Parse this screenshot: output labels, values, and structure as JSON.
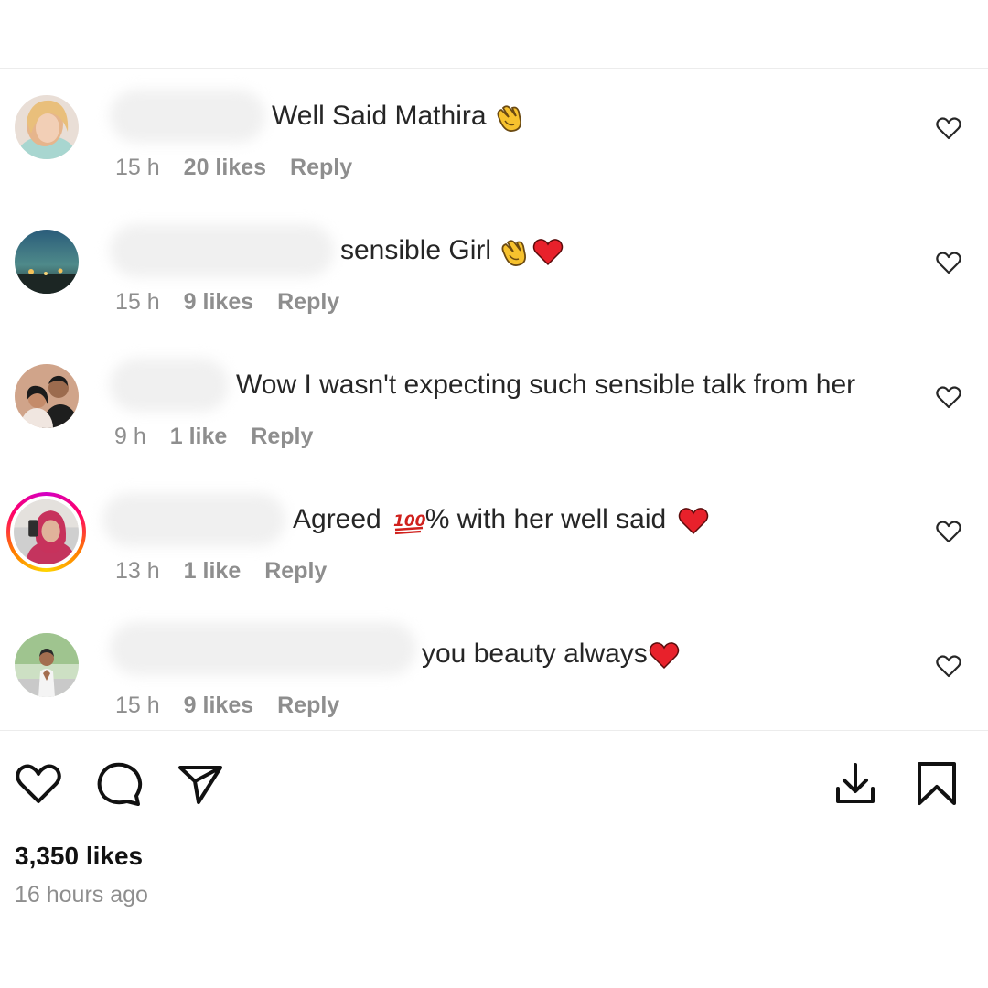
{
  "comments": [
    {
      "text": "Well Said Mathira",
      "emojis": [
        "clapping-hands"
      ],
      "time": "15 h",
      "likes": "20 likes",
      "reply": "Reply",
      "avatar": "woman-blonde-avatar",
      "story_ring": false
    },
    {
      "text": "sensible Girl",
      "emojis": [
        "clapping-hands",
        "red-heart"
      ],
      "time": "15 h",
      "likes": "9 likes",
      "reply": "Reply",
      "avatar": "city-night-avatar",
      "story_ring": false
    },
    {
      "text": "Wow I wasn't expecting such sensible talk from her",
      "emojis": [],
      "time": "9 h",
      "likes": "1 like",
      "reply": "Reply",
      "avatar": "couple-avatar",
      "story_ring": false
    },
    {
      "text_before": "Agreed",
      "text_after": "% with her well said",
      "emojis": [
        "hundred-points",
        "red-heart"
      ],
      "time": "13 h",
      "likes": "1 like",
      "reply": "Reply",
      "avatar": "pink-hijab-avatar",
      "story_ring": true
    },
    {
      "text": "you beauty always",
      "emojis": [
        "red-heart"
      ],
      "time": "15 h",
      "likes": "9 likes",
      "reply": "Reply",
      "avatar": "man-standing-avatar",
      "story_ring": false
    }
  ],
  "actions": {
    "like": "heart-icon",
    "comment": "comment-icon",
    "share": "send-icon",
    "download": "download-icon",
    "save": "bookmark-icon"
  },
  "post": {
    "likes": "3,350 likes",
    "time_ago": "16 hours ago"
  },
  "colors": {
    "text": "#262626",
    "muted": "#8e8e8e",
    "heart_red": "#e8212b",
    "clap_yellow": "#f7c22e"
  }
}
